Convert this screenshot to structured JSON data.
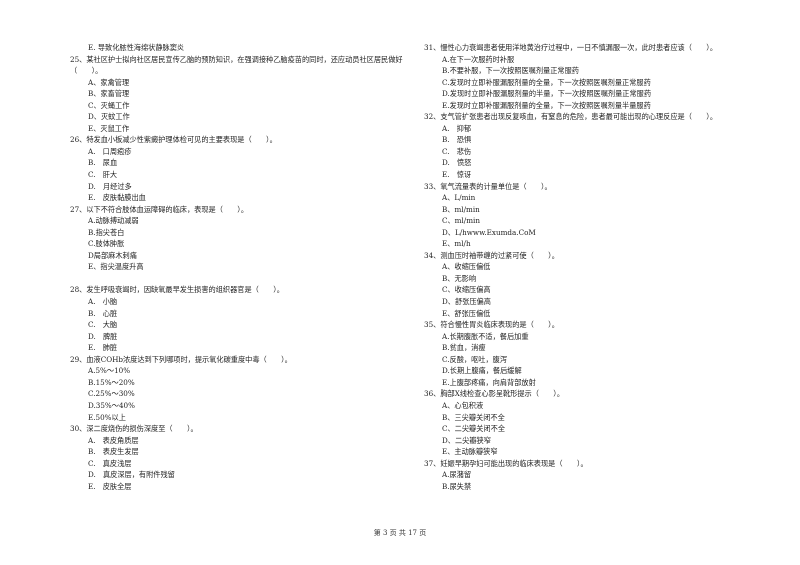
{
  "left_column": [
    {
      "stem": "",
      "options": [
        "E. 导致化脓性海绵状静脉窦炎"
      ]
    },
    {
      "stem": "25、某社区护士拟向社区居民宣传乙脑的预防知识，在强调接种乙脑疫苗的同时，还应动员社区居民做好（　　）。",
      "options": [
        "A、家禽管理",
        "B、家畜管理",
        "C、灭蝇工作",
        "D、灭蚊工作",
        "E、灭鼠工作"
      ]
    },
    {
      "stem": "26、特发血小板减少性紫癜护理体检可见的主要表现是（　　）。",
      "options": [
        "A.　口周疱疹",
        "B.　尿血",
        "C.　肝大",
        "D.　月经过多",
        "E.　皮肤黏膜出血"
      ]
    },
    {
      "stem": "27、以下不符合肢体血运障碍的临床，表现是（　　）。",
      "options": [
        "A.动脉搏动减弱",
        "B.指尖苍白",
        "C.肢体肿胀",
        "D局部麻木刺痛",
        "E、指尖温度升高"
      ],
      "gap_after": true
    },
    {
      "stem": "28、发生呼吸衰竭时，因缺氧最早发生损害的组织器官是（　　）。",
      "options": [
        "A.　小脑",
        "B.　心脏",
        "C.　大脑",
        "D.　脾脏",
        "E.　肺脏"
      ]
    },
    {
      "stem": "29、血液COHb浓度达到下列哪项时，提示氧化碳重度中毒（　　）。",
      "options": [
        "A.5%～10%",
        "B.15%～20%",
        "C.25%～30%",
        "D.35%～40%",
        "E.50%以上"
      ]
    },
    {
      "stem": "30、深二度烧伤的损伤深度至（　　）。",
      "options": [
        "A.　表皮角质层",
        "B.　表皮生发层",
        "C.　真皮浅层",
        "D.　真皮深层，有附件残留",
        "E.　皮肤全层"
      ]
    }
  ],
  "right_column": [
    {
      "stem": "31、慢性心力衰竭患者使用洋地黄治疗过程中，一日不慎漏服一次，此时患者应该（　　）。",
      "options": [
        "A.在下一次服药时补服",
        "B.不要补服，下一次按照医嘱剂量正常服药",
        "C.发现时立即补服漏服剂量的全量，下一次按照医嘱剂量正常服药",
        "D.发现时立即补服漏服剂量的半量，下一次按照医嘱剂量正常服药",
        "E.发现时立即补服漏服剂量的全量，下一次按照医嘱剂量半量服药"
      ]
    },
    {
      "stem": "32、支气管扩张患者出现反复咳血，有窒息的危险，患者最可能出现的心理反应是（　　）。",
      "options": [
        "A.　抑郁",
        "B.　恐惧",
        "C.　悲伤",
        "D.　愤怒",
        "E.　惊讶"
      ]
    },
    {
      "stem": "33、氧气流量表的计量单位是（　　）。",
      "options": [
        "A、L/min",
        "B、ml/min",
        "C、ml/min",
        "D、L/hwww.Exumda.CoM",
        "E、ml/h"
      ]
    },
    {
      "stem": "34、测血压时袖带缠的过紧可使（　　）。",
      "options": [
        "A、收缩压偏低",
        "B、无影响",
        "C、收缩压偏高",
        "D、舒张压偏高",
        "E、舒张压偏低"
      ]
    },
    {
      "stem": "35、符合慢性胃炎临床表现的是（　　）。",
      "options": [
        "A.长期腹胀不适，餐后加重",
        "B.贫血，消瘦",
        "C.反酸，呕吐，腹泻",
        "D.长期上腹痛，餐后缓解",
        "E.上腹部疼痛，向肩背部放射"
      ]
    },
    {
      "stem": "36、胸部X线检查心影呈靴形提示（　　）。",
      "options": [
        "A、心包积液",
        "B、三尖瓣关闭不全",
        "C、二尖瓣关闭不全",
        "D、二尖瓣狭窄",
        "E、主动脉瓣狭窄"
      ]
    },
    {
      "stem": "37、妊娠早期孕妇可能出现的临床表现是（　　）。",
      "options": [
        "A.尿潴留",
        "B.尿失禁"
      ]
    }
  ],
  "footer": {
    "page_label": "第 3 页 共 17 页"
  }
}
